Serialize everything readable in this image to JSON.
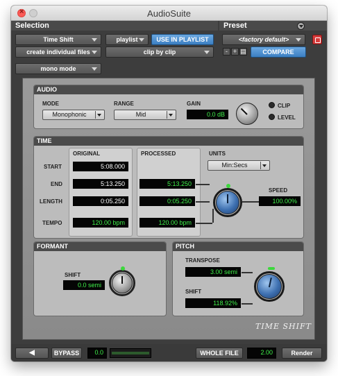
{
  "window": {
    "title": "AudioSuite"
  },
  "selection": {
    "header": "Selection",
    "plugin": "Time Shift",
    "playlist": "playlist",
    "use_in_playlist": "USE IN PLAYLIST",
    "file_mode": "create individual files",
    "processing": "clip by clip",
    "channel_mode": "mono mode"
  },
  "preset": {
    "header": "Preset",
    "name": "<factory default>",
    "minus": "-",
    "plus": "+",
    "compare": "COMPARE"
  },
  "audio": {
    "header": "AUDIO",
    "mode_label": "MODE",
    "mode_value": "Monophonic",
    "range_label": "RANGE",
    "range_value": "Mid",
    "gain_label": "GAIN",
    "gain_value": "0.0 dB",
    "clip_label": "CLIP",
    "level_label": "LEVEL"
  },
  "time": {
    "header": "TIME",
    "original_label": "ORIGINAL",
    "processed_label": "PROCESSED",
    "units_label": "UNITS",
    "units_value": "Min:Secs",
    "start_label": "START",
    "end_label": "END",
    "length_label": "LENGTH",
    "tempo_label": "TEMPO",
    "speed_label": "SPEED",
    "original_start": "5:08.000",
    "original_end": "5:13.250",
    "original_length": "0:05.250",
    "original_tempo": "120.00 bpm",
    "processed_end": "5:13.250",
    "processed_length": "0:05.250",
    "processed_tempo": "120.00 bpm",
    "speed_value": "100.00%"
  },
  "formant": {
    "header": "FORMANT",
    "shift_label": "SHIFT",
    "shift_value": "0.0 semi"
  },
  "pitch": {
    "header": "PITCH",
    "transpose_label": "TRANSPOSE",
    "transpose_value": "3.00 semi",
    "shift_label": "SHIFT",
    "shift_value": "118.92%"
  },
  "logo": "TIME SHIFT",
  "bottom": {
    "bypass": "BYPASS",
    "level": "0.0",
    "whole_file": "WHOLE FILE",
    "handle": "2.00",
    "render": "Render"
  },
  "colors": {
    "display_green": "#3ff04a",
    "accent_blue": "#3b7fc2",
    "close_red": "#fc5b57"
  }
}
